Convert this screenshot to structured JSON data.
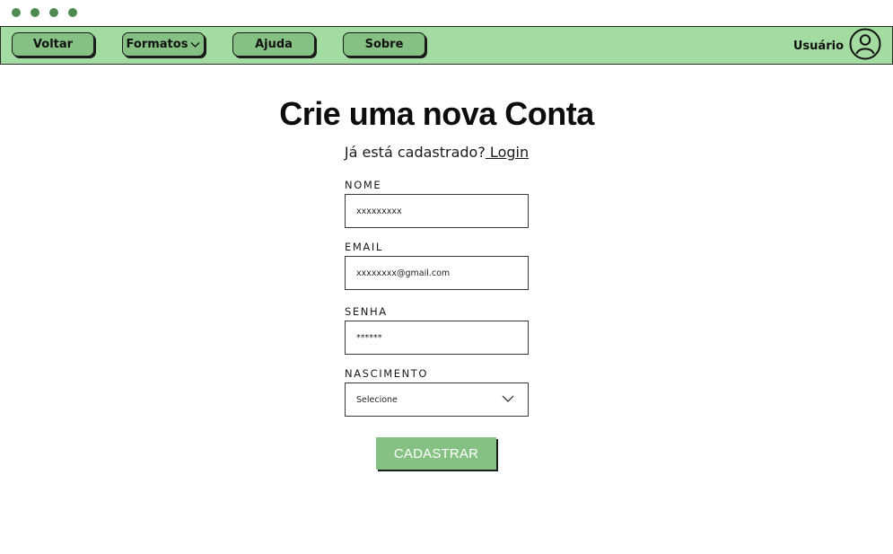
{
  "nav": {
    "back_label": "Voltar",
    "formats_label": "Formatos",
    "help_label": "Ajuda",
    "about_label": "Sobre",
    "user_label": "Usuário"
  },
  "form": {
    "title": "Crie uma nova Conta",
    "already_registered": "Já está cadastrado?",
    "login_link": " Login",
    "fields": {
      "name": {
        "label": "NOME",
        "value": "xxxxxxxxx"
      },
      "email": {
        "label": "EMAIL",
        "value": "xxxxxxxx@gmail.com"
      },
      "password": {
        "label": "SENHA",
        "value": "******"
      },
      "birth": {
        "label": "NASCIMENTO",
        "value": "Selecione"
      }
    },
    "submit_label": "CADASTRAR"
  },
  "icons": {
    "window_dots": "dots",
    "formats_dropdown": "chevron-down-icon",
    "user": "user-avatar-icon",
    "select_dropdown": "chevron-down-icon"
  },
  "colors": {
    "nav_bg": "#a3dca0",
    "button_bg": "#86c184",
    "dot": "#4f8a52"
  }
}
